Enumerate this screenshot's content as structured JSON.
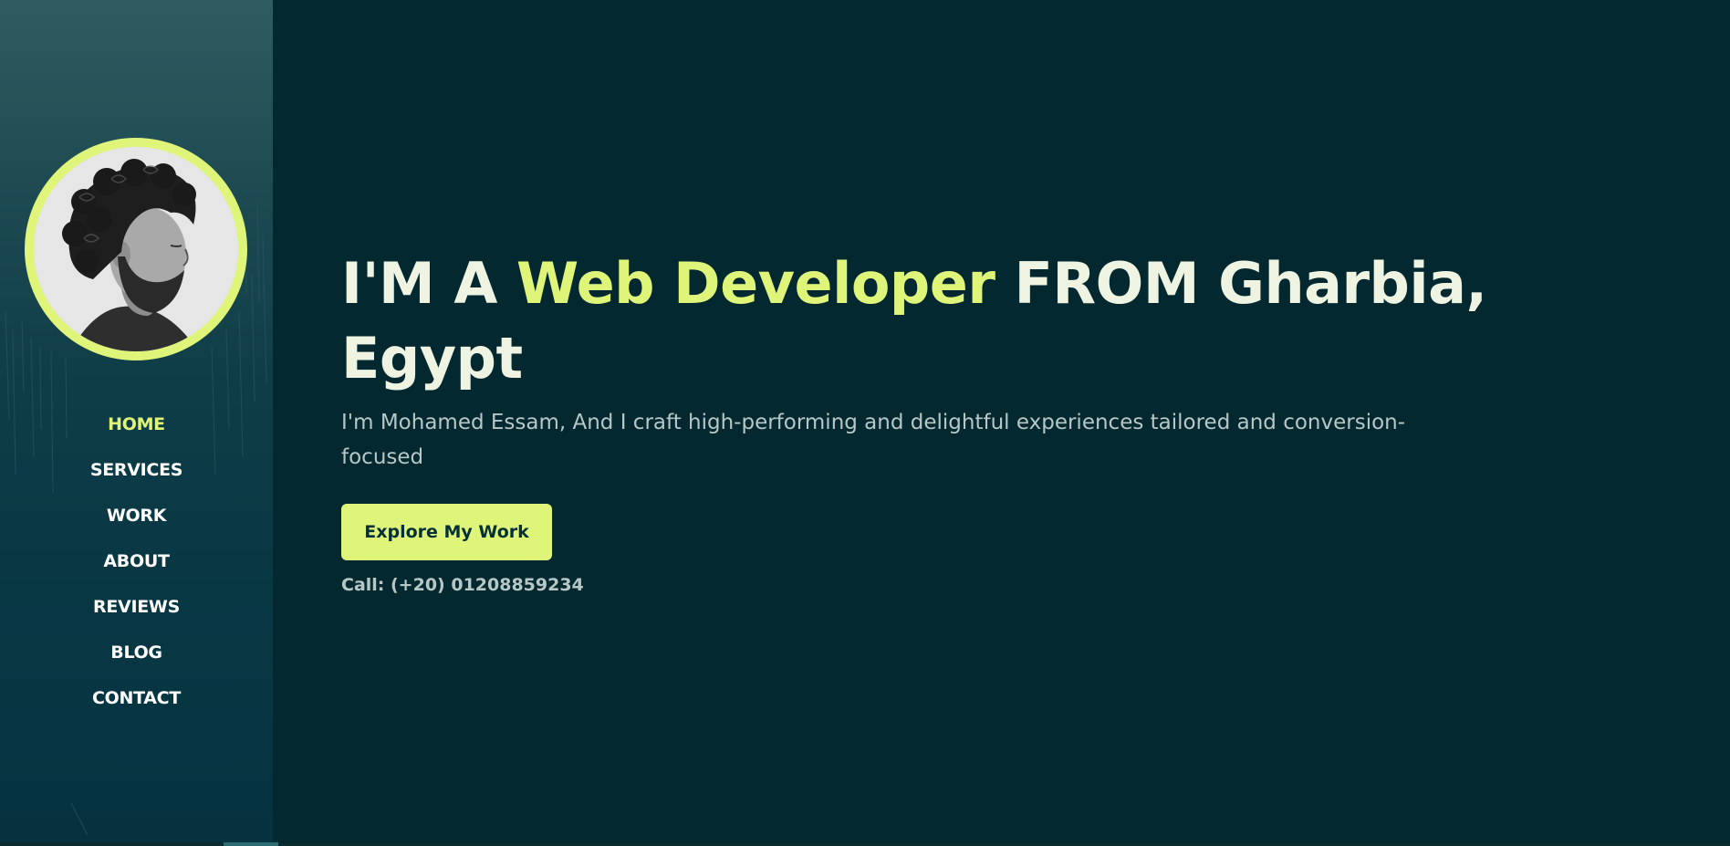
{
  "sidebar": {
    "avatar_icon": "portrait-photo",
    "nav_items": [
      {
        "label": "HOME",
        "active": true
      },
      {
        "label": "SERVICES",
        "active": false
      },
      {
        "label": "WORK",
        "active": false
      },
      {
        "label": "ABOUT",
        "active": false
      },
      {
        "label": "REVIEWS",
        "active": false
      },
      {
        "label": "BLOG",
        "active": false
      },
      {
        "label": "CONTACT",
        "active": false
      }
    ]
  },
  "hero": {
    "title_prefix": "I'M A ",
    "title_highlight": "Web Developer",
    "title_suffix": " FROM Gharbia, Egypt",
    "subtitle": "I'm Mohamed Essam, And I craft high-performing and delightful experiences tailored and conversion-focused",
    "cta_label": "Explore My Work",
    "call_text": "Call: (+20) 01208859234"
  },
  "colors": {
    "background": "#03282f",
    "accent": "#dff57a",
    "heading": "#eef3e2",
    "muted_text": "#b7c7c6"
  }
}
